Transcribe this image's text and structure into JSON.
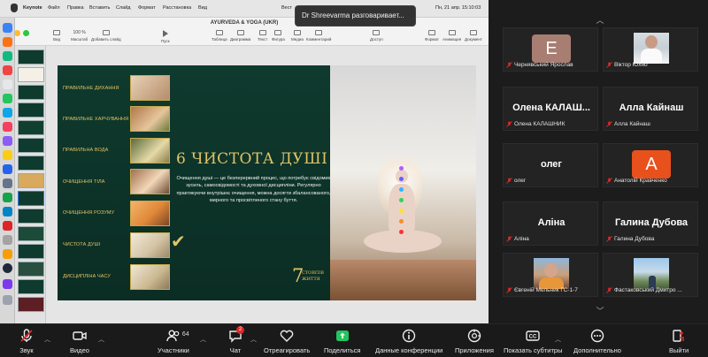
{
  "mac_menu": {
    "app": "Keynote",
    "items": [
      "Файл",
      "Правка",
      "Вставить",
      "Слайд",
      "Формат",
      "Расстановка",
      "Вид"
    ],
    "partial_item": "Вест",
    "datetime": "Пн, 21 апр.  15:10:03"
  },
  "keynote": {
    "doc_title": "AYURVEDA & YOGA (UKR)",
    "zoom": "100 %",
    "toolbar": {
      "view": "Вид",
      "zoom_label": "Масштаб",
      "add_slide": "Добавить слайд",
      "play": "Пуск",
      "table": "Таблица",
      "chart": "Диаграмма",
      "text": "Текст",
      "shape": "Фигура",
      "media": "Медиа",
      "comment": "Комментарий",
      "share": "Доступ",
      "format": "Формат",
      "animate": "Анимация",
      "document": "Документ"
    }
  },
  "slide": {
    "menu": [
      "Правильне дихання",
      "Правильне харчування",
      "Правильна вода",
      "Очищення тіла",
      "Очищення розуму",
      "Чистота душі",
      "Дисципліна часу"
    ],
    "heading": "6 ЧИСТОТА ДУШІ",
    "body": "Очищення душі — це безперервний процес, що потребує свідомих зусиль, самосвідомості та духовної дисципліни. Регулярно практикуючи внутрішнє очищення, можна досягти збалансованого, мирного та просвітленого стану буття.",
    "logo_number": "7",
    "logo_line1": "СТОВПІВ",
    "logo_line2": "ЖИТТЯ"
  },
  "speaking": "Dr Shreevarma разговаривает...",
  "participants": [
    {
      "name": "Чернявський Ярослав",
      "kind": "avatar",
      "initial": "E",
      "color": "#a87e72"
    },
    {
      "name": "Віктор Юхно",
      "kind": "photo"
    },
    {
      "name": "Олена КАЛАШНИК",
      "kind": "text",
      "big": "Олена  КАЛАШ..."
    },
    {
      "name": "Алла Кайнаш",
      "kind": "text",
      "big": "Алла Кайнаш"
    },
    {
      "name": "олег",
      "kind": "text",
      "big": "олег"
    },
    {
      "name": "Анатолій Кравченко",
      "kind": "avatar",
      "initial": "A",
      "color": "#e8501c"
    },
    {
      "name": "Аліна",
      "kind": "text",
      "big": "Аліна"
    },
    {
      "name": "Галина Дубова",
      "kind": "text",
      "big": "Галина Дубова"
    },
    {
      "name": "Євгеній Мельник ГС-1-7",
      "kind": "photo"
    },
    {
      "name": "Фастаковський Дмитро ...",
      "kind": "photo"
    }
  ],
  "zoom_toolbar": {
    "audio": "Звук",
    "video": "Видео",
    "participants": "Участники",
    "participant_count": "64",
    "chat": "Чат",
    "chat_badge": "2",
    "react": "Отреагировать",
    "share": "Поделиться",
    "meeting_info": "Данные конференции",
    "apps": "Приложения",
    "captions": "Показать субтитры",
    "more": "Дополнительно",
    "leave": "Выйти"
  },
  "colors": {
    "slide_green": "#0f3a2e",
    "slide_gold": "#e2c467",
    "share_green": "#23c55e",
    "mic_red": "#e02828"
  }
}
